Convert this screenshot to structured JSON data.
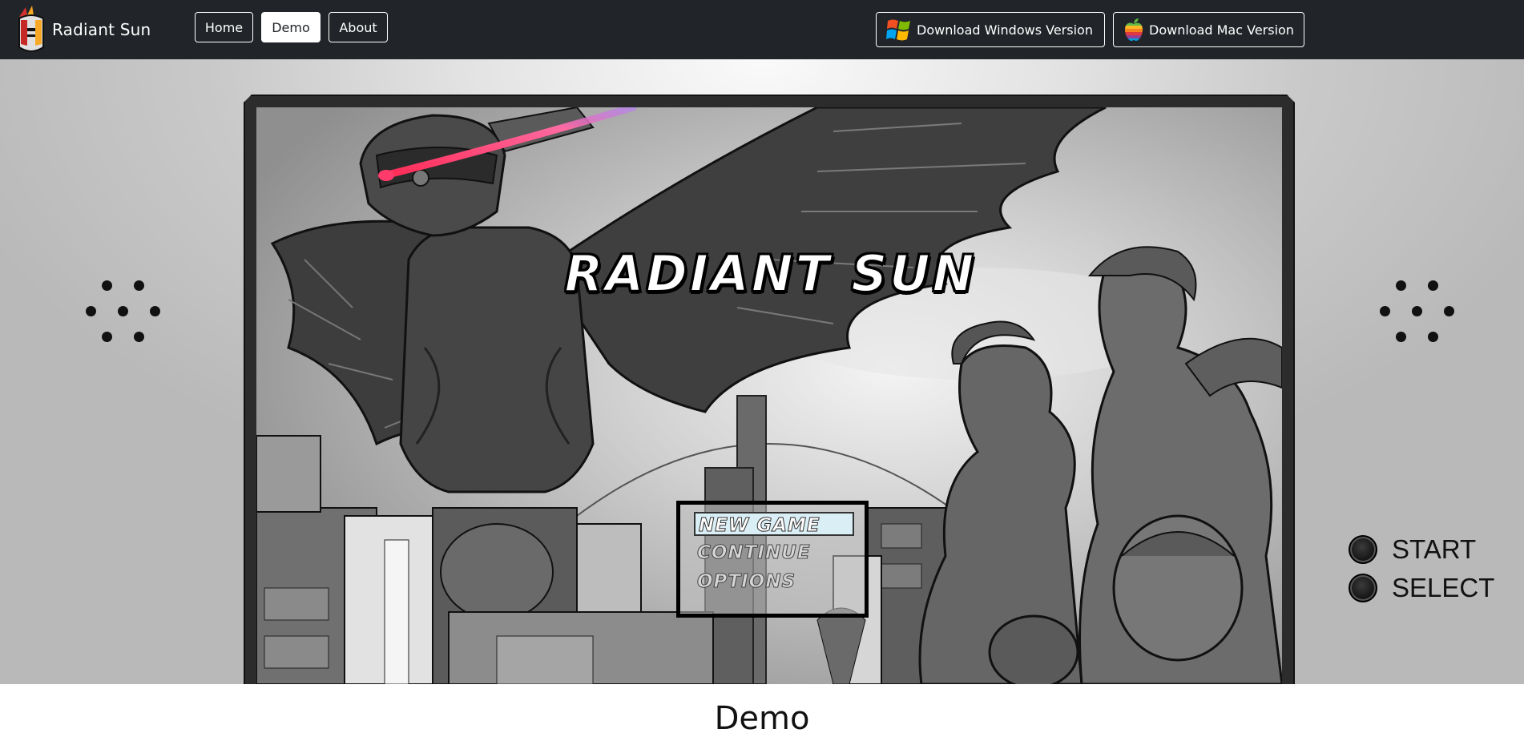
{
  "brand": {
    "name": "Radiant Sun",
    "logo_icon": "knight-helmet-icon"
  },
  "nav": {
    "links": [
      {
        "label": "Home",
        "active": false
      },
      {
        "label": "Demo",
        "active": true
      },
      {
        "label": "About",
        "active": false
      }
    ],
    "downloads": [
      {
        "label": "Download Windows Version",
        "icon": "windows-logo-icon"
      },
      {
        "label": "Download Mac Version",
        "icon": "apple-logo-icon"
      }
    ]
  },
  "game": {
    "title": "RADIANT SUN",
    "menu": [
      {
        "label": "NEW GAME",
        "selected": true
      },
      {
        "label": "CONTINUE",
        "selected": false
      },
      {
        "label": "OPTIONS",
        "selected": false
      }
    ]
  },
  "console": {
    "buttons": [
      {
        "label": "START"
      },
      {
        "label": "SELECT"
      }
    ],
    "speaker_icon": "speaker-grille-icon"
  },
  "page": {
    "heading": "Demo"
  },
  "colors": {
    "navbar": "#212529",
    "background": "#ffffff",
    "accent_laser": "#ff3b6b"
  }
}
